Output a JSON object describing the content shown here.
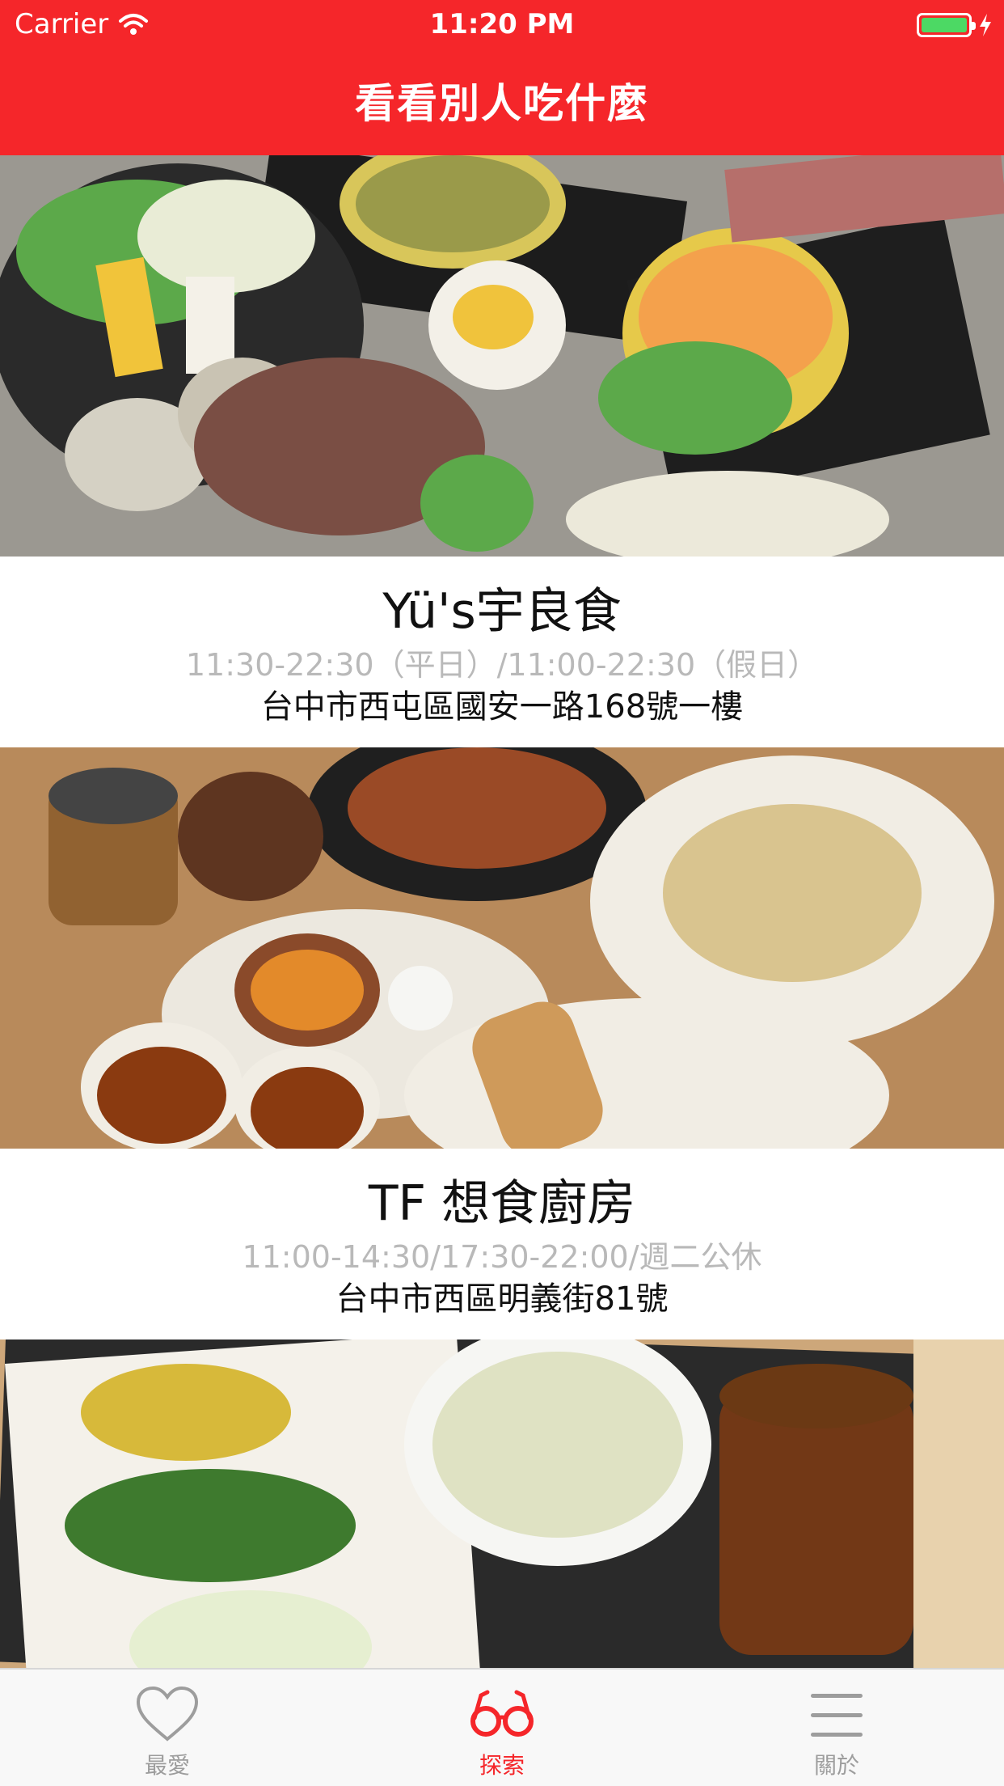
{
  "status_bar": {
    "carrier": "Carrier",
    "time": "11:20 PM"
  },
  "nav": {
    "title": "看看別人吃什麼"
  },
  "restaurants": [
    {
      "name": "Yü's宇良食",
      "hours": "11:30-22:30（平日）/11:00-22:30（假日）",
      "address": "台中市西屯區國安一路168號一樓"
    },
    {
      "name": "TF 想食廚房",
      "hours": "11:00-14:30/17:30-22:00/週二公休",
      "address": "台中市西區明義街81號"
    }
  ],
  "tabs": [
    {
      "label": "最愛",
      "icon": "heart-icon",
      "active": false
    },
    {
      "label": "探索",
      "icon": "glasses-icon",
      "active": true
    },
    {
      "label": "關於",
      "icon": "menu-icon",
      "active": false
    }
  ],
  "colors": {
    "accent": "#f5262a",
    "inactive_tab": "#9d9d9d",
    "hours_text": "#b9b9b9"
  }
}
